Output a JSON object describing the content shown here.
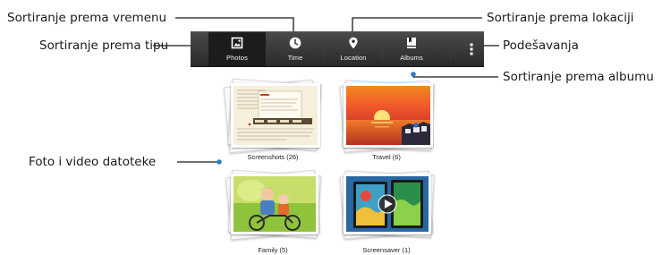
{
  "action_bar": {
    "tabs": [
      {
        "label": "Photos",
        "icon": "photos-icon",
        "selected": true
      },
      {
        "label": "Time",
        "icon": "clock-icon",
        "selected": false
      },
      {
        "label": "Location",
        "icon": "location-pin-icon",
        "selected": false
      },
      {
        "label": "Albums",
        "icon": "album-icon",
        "selected": false
      }
    ],
    "overflow_icon": "overflow-menu-icon",
    "colors": {
      "bar": "#333333",
      "selected": "#1c1c1c",
      "accent": "#2d7dc8"
    }
  },
  "callouts": {
    "sort_time": "Sortiranje prema vremenu",
    "sort_type": "Sortiranje prema tipu",
    "sort_location": "Sortiranje prema lokaciji",
    "settings": "Podešavanja",
    "sort_album": "Sortiranje prema albumu",
    "media_files": "Foto i video datoteke"
  },
  "albums": [
    {
      "caption": "Screenshots (26)",
      "kind": "screenshot"
    },
    {
      "caption": "Travel (6)",
      "kind": "sunset"
    },
    {
      "caption": "Family (5)",
      "kind": "family"
    },
    {
      "caption": "Screensaver (1)",
      "kind": "video"
    }
  ]
}
